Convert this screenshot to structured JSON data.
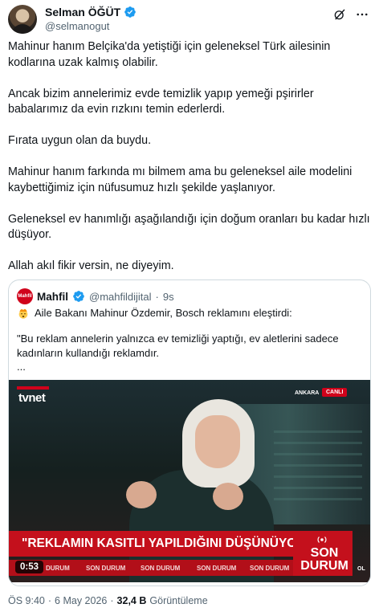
{
  "author": {
    "name": "Selman ÖĞÜT",
    "handle": "@selmanogut",
    "verified_color": "#1d9bf0"
  },
  "icons": [
    "grok-icon",
    "more-icon",
    "verified-badge-icon",
    "mind-blown-emoji-icon"
  ],
  "tweet": {
    "paragraphs": [
      "Mahinur hanım Belçika'da yetiştiği için geleneksel Türk ailesinin kodlarına uzak kalmış olabilir.",
      "Ancak bizim annelerimiz evde temizlik yapıp yemeği pşirirler babalarımız da evin rızkını temin ederlerdi.",
      "Fırata uygun olan da buydu.",
      "Mahinur hanım farkında mı bilmem ama bu geleneksel aile modelini kaybettiğimiz için nüfusumuz hızlı şekilde yaşlanıyor.",
      "Geleneksel ev hanımlığı aşağılandığı için doğum oranları bu kadar hızlı düşüyor.",
      "Allah akıl fikir versin, ne diyeyim."
    ]
  },
  "quote": {
    "logo_text": "Mahfil",
    "name": "Mahfil",
    "handle": "@mahfildijital",
    "dot": "·",
    "time": "9s",
    "line1": "Aile Bakanı Mahinur Özdemir, Bosch reklamını eleştirdi:",
    "line2": "\"Bu reklam annelerin yalnızca ev temizliği yaptığı, ev aletlerini sadece kadınların kullandığı reklamdır.",
    "ellipsis": "..."
  },
  "video": {
    "channel": "tvnet",
    "location": "ANKARA",
    "live": "CANLI",
    "banner": "\"REKLAMIN KASITLI YAPILDIĞINI DÜŞÜNÜYORUM\"",
    "son_durum": "SON DURUM",
    "ticker": [
      "DURUM",
      "SON DURUM",
      "SON DURUM",
      "SON DURUM",
      "SON DURUM"
    ],
    "corner": "OL",
    "duration": "0:53"
  },
  "meta": {
    "time": "ÖS 9:40",
    "sep": "·",
    "date": "6 May 2026",
    "views_count": "32,4 B",
    "views_label": "Görüntüleme"
  }
}
